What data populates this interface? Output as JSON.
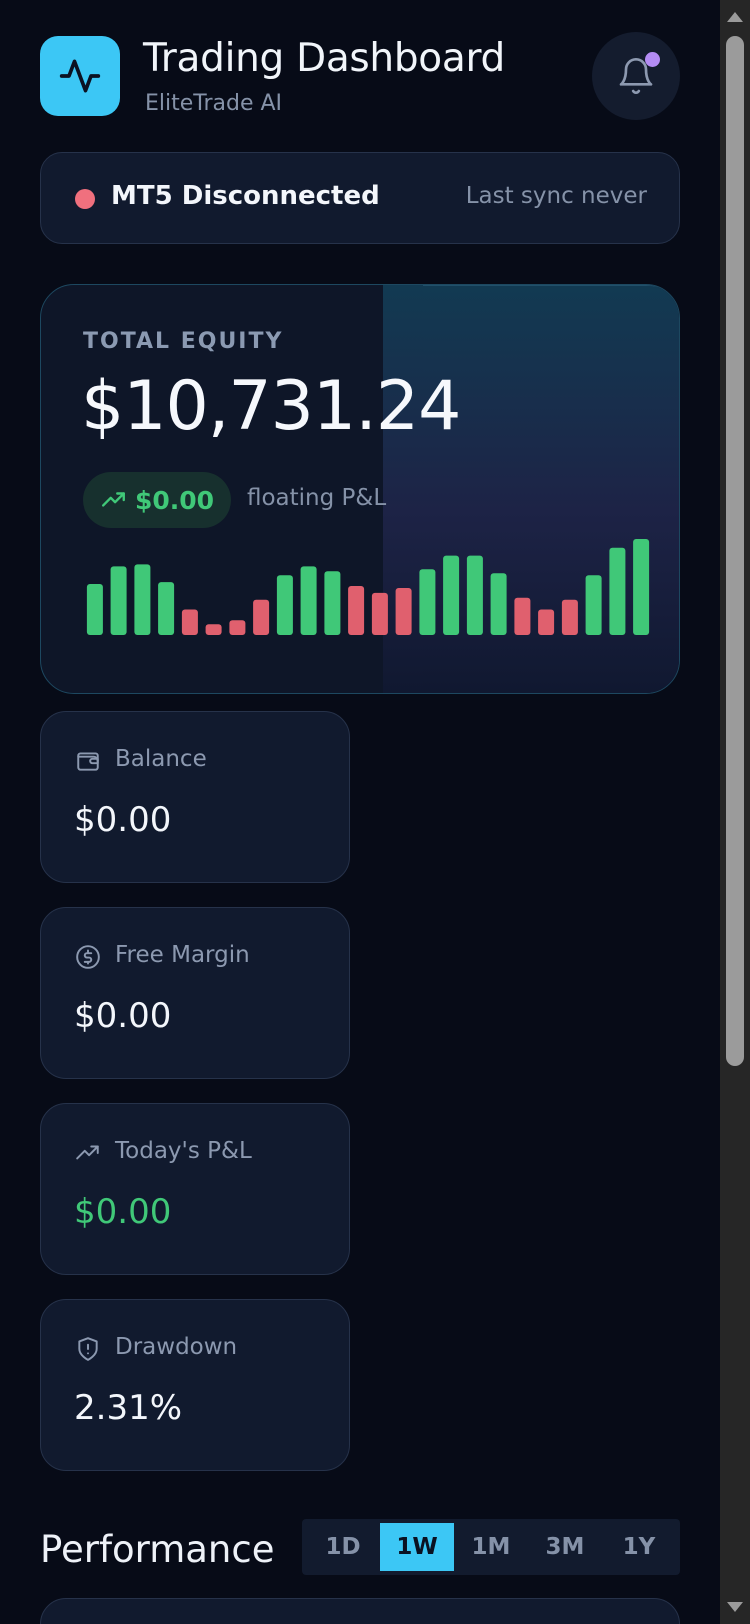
{
  "header": {
    "title": "Trading Dashboard",
    "subtitle": "EliteTrade AI",
    "logo_icon": "activity-pulse-icon",
    "notification_icon": "bell-icon",
    "has_unread_notification": true,
    "accent_color": "#3cc7f5"
  },
  "status": {
    "text": "MT5 Disconnected",
    "sync": "Last sync never",
    "state_color": "#f0707e"
  },
  "equity": {
    "label": "TOTAL EQUITY",
    "value": "$10,731.24",
    "floating_value": "$0.00",
    "floating_label": "floating P&L",
    "floating_icon": "trend-up-icon",
    "bars": [
      {
        "v": 0.52,
        "up": true
      },
      {
        "v": 0.7,
        "up": true
      },
      {
        "v": 0.72,
        "up": true
      },
      {
        "v": 0.54,
        "up": true
      },
      {
        "v": 0.26,
        "up": false
      },
      {
        "v": 0.11,
        "up": false
      },
      {
        "v": 0.15,
        "up": false
      },
      {
        "v": 0.36,
        "up": false
      },
      {
        "v": 0.61,
        "up": true
      },
      {
        "v": 0.7,
        "up": true
      },
      {
        "v": 0.65,
        "up": true
      },
      {
        "v": 0.5,
        "up": false
      },
      {
        "v": 0.43,
        "up": false
      },
      {
        "v": 0.48,
        "up": false
      },
      {
        "v": 0.67,
        "up": true
      },
      {
        "v": 0.81,
        "up": true
      },
      {
        "v": 0.81,
        "up": true
      },
      {
        "v": 0.63,
        "up": true
      },
      {
        "v": 0.38,
        "up": false
      },
      {
        "v": 0.26,
        "up": false
      },
      {
        "v": 0.36,
        "up": false
      },
      {
        "v": 0.61,
        "up": true
      },
      {
        "v": 0.89,
        "up": true
      },
      {
        "v": 0.98,
        "up": true
      }
    ],
    "up_color": "#40c878",
    "down_color": "#e0606e"
  },
  "stats": [
    {
      "label": "Balance",
      "value": "$0.00",
      "icon": "wallet-icon"
    },
    {
      "label": "Free Margin",
      "value": "$0.00",
      "icon": "dollar-circle-icon"
    },
    {
      "label": "Today's P&L",
      "value": "$0.00",
      "icon": "trend-up-icon"
    },
    {
      "label": "Drawdown",
      "value": "2.31%",
      "icon": "shield-alert-icon"
    }
  ],
  "performance": {
    "title": "Performance",
    "ranges": [
      "1D",
      "1W",
      "1M",
      "3M",
      "1Y"
    ],
    "selected": "1W"
  }
}
